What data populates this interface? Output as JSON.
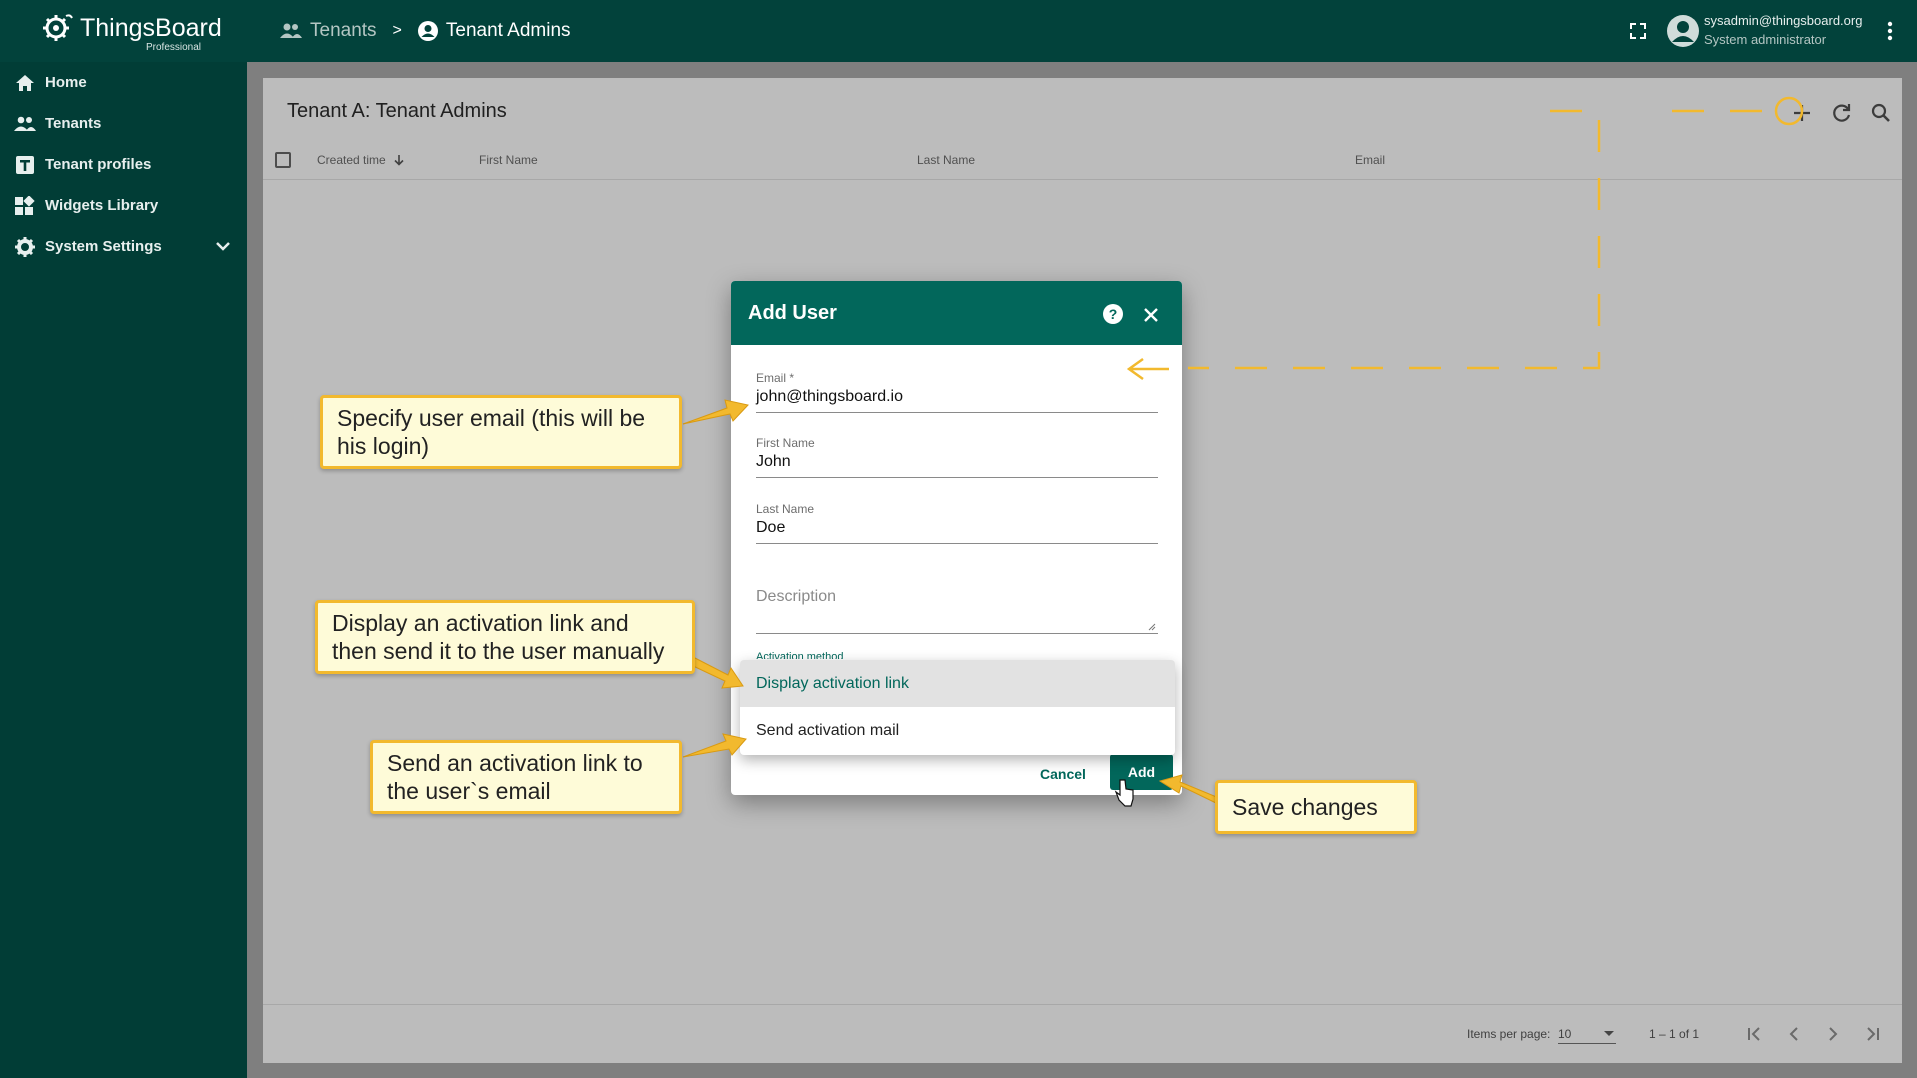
{
  "app": {
    "name": "ThingsBoard",
    "edition": "Professional"
  },
  "breadcrumb": {
    "items": [
      {
        "label": "Tenants",
        "icon": "tenants-icon"
      },
      {
        "label": "Tenant Admins",
        "icon": "account-circle-icon"
      }
    ],
    "separator": ">"
  },
  "user": {
    "email": "sysadmin@thingsboard.org",
    "role": "System administrator"
  },
  "sidebar": {
    "items": [
      {
        "label": "Home",
        "icon": "home-icon"
      },
      {
        "label": "Tenants",
        "icon": "tenants-icon"
      },
      {
        "label": "Tenant profiles",
        "icon": "tenant-profile-icon"
      },
      {
        "label": "Widgets Library",
        "icon": "widgets-icon"
      },
      {
        "label": "System Settings",
        "icon": "gear-icon"
      }
    ]
  },
  "page": {
    "title": "Tenant A: Tenant Admins",
    "columns": [
      "Created time",
      "First Name",
      "Last Name",
      "Email"
    ]
  },
  "pagination": {
    "items_per_page_label": "Items per page:",
    "items_per_page": "10",
    "range": "1 – 1 of 1"
  },
  "dialog": {
    "title": "Add User",
    "email_label": "Email *",
    "email_value": "john@thingsboard.io",
    "first_name_label": "First Name",
    "first_name_value": "John",
    "last_name_label": "Last Name",
    "last_name_value": "Doe",
    "description_placeholder": "Description",
    "activation_label": "Activation method",
    "cancel_label": "Cancel",
    "add_label": "Add"
  },
  "activation_options": [
    {
      "label": "Display activation link",
      "selected": true
    },
    {
      "label": "Send activation mail",
      "selected": false
    }
  ],
  "callouts": {
    "email": "Specify user email (this will be his login)",
    "display_link": "Display an activation link and then send it to the user manually",
    "send_mail": "Send an activation link to the user`s email",
    "save": "Save changes"
  },
  "colors": {
    "primary": "#02675b",
    "topbar": "#02423b",
    "sidebar": "#013d36",
    "callout_border": "#f2b92e",
    "callout_fill": "#fefbd8"
  }
}
